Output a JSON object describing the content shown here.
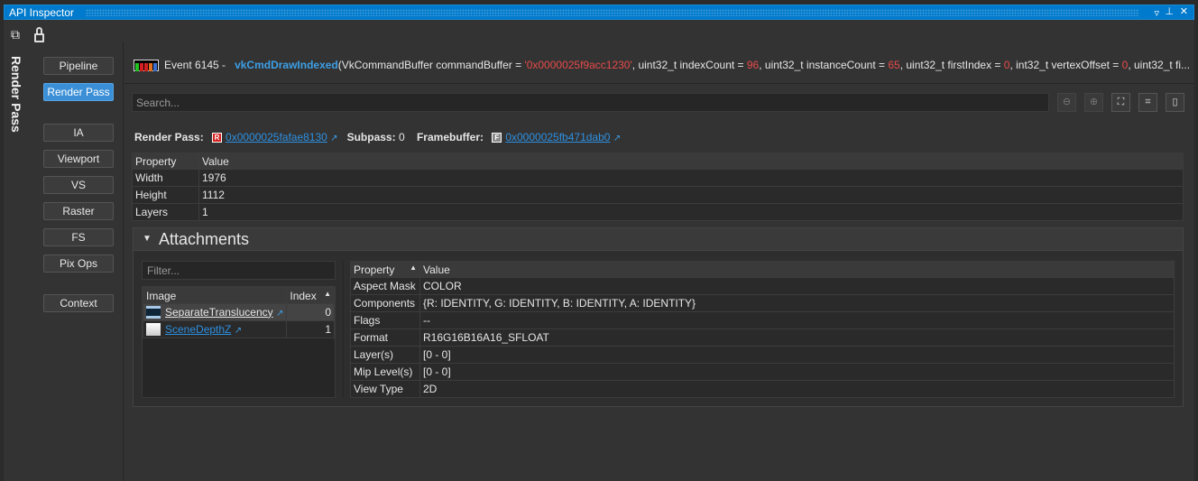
{
  "window": {
    "title": "API Inspector",
    "controls": [
      "dropdown-icon",
      "pin-icon",
      "close-icon"
    ]
  },
  "toolbar": {
    "icons": [
      "copy-window-icon",
      "lock-icon"
    ]
  },
  "side_label": "Render Pass",
  "nav": [
    {
      "label": "Pipeline"
    },
    {
      "label": "Render Pass",
      "active": true
    },
    {
      "label": "IA"
    },
    {
      "label": "Viewport"
    },
    {
      "label": "VS"
    },
    {
      "label": "Raster"
    },
    {
      "label": "FS"
    },
    {
      "label": "Pix Ops"
    },
    {
      "label": "Context"
    }
  ],
  "event": {
    "prefix": "Event 6145 -",
    "func": "vkCmdDrawIndexed",
    "p1": "(VkCommandBuffer commandBuffer = ",
    "v1": "'0x0000025f9acc1230'",
    "p2": ", uint32_t indexCount = ",
    "v2": "96",
    "p3": ", uint32_t instanceCount = ",
    "v3": "65",
    "p4": ", uint32_t firstIndex = ",
    "v4": "0",
    "p5": ", int32_t vertexOffset = ",
    "v5": "0",
    "p6": ", uint32_t fi...",
    "colors": [
      "#22c322",
      "#d42020",
      "#d42020",
      "#e07020",
      "#3a6fd0"
    ]
  },
  "search": {
    "placeholder": "Search..."
  },
  "render_pass": {
    "label": "Render Pass:",
    "badge": "R",
    "handle": "0x0000025fafae8130",
    "subpass_label": "Subpass:",
    "subpass": "0",
    "fb_label": "Framebuffer:",
    "fb_badge": "F",
    "fb_handle": "0x0000025fb471dab0"
  },
  "fb_table": {
    "headers": [
      "Property",
      "Value"
    ],
    "rows": [
      [
        "Width",
        "1976"
      ],
      [
        "Height",
        "1112"
      ],
      [
        "Layers",
        "1"
      ]
    ]
  },
  "attachments": {
    "title": "Attachments",
    "filter_placeholder": "Filter...",
    "images": {
      "headers": [
        "Image",
        "Index"
      ],
      "rows": [
        {
          "name": "SeparateTranslucency",
          "index": "0"
        },
        {
          "name": "SceneDepthZ",
          "index": "1"
        }
      ]
    },
    "props": {
      "headers": [
        "Property",
        "Value"
      ],
      "rows": [
        [
          "Aspect Mask",
          "COLOR"
        ],
        [
          "Components",
          "{R: IDENTITY, G: IDENTITY, B: IDENTITY, A: IDENTITY}"
        ],
        [
          "Flags",
          "--"
        ],
        [
          "Format",
          "R16G16B16A16_SFLOAT"
        ],
        [
          "Layer(s)",
          "[0 - 0]"
        ],
        [
          "Mip Level(s)",
          "[0 - 0]"
        ],
        [
          "View Type",
          "2D"
        ]
      ]
    }
  }
}
